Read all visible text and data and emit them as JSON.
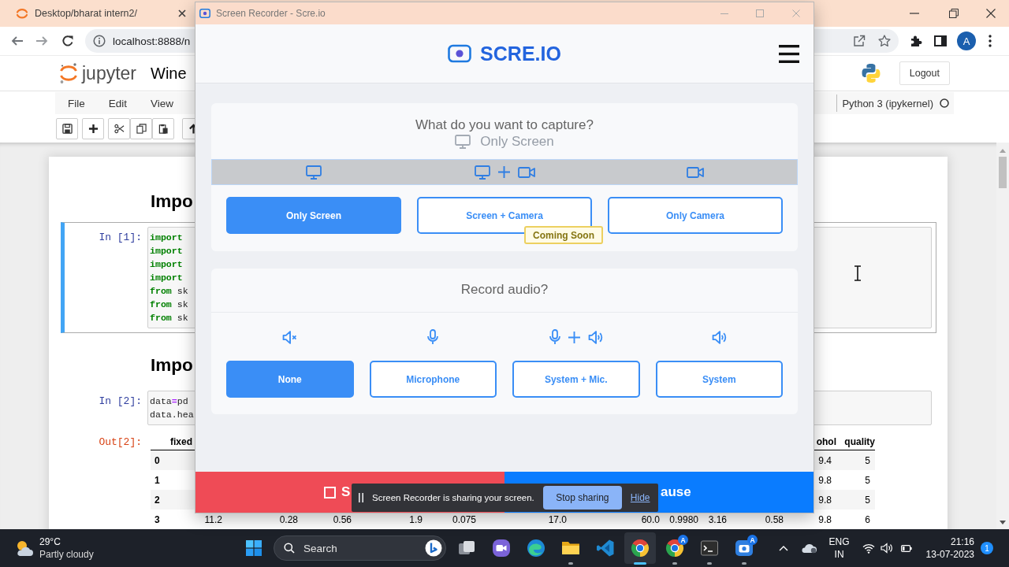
{
  "browser": {
    "tab_title": "Desktop/bharat intern2/",
    "url": "localhost:8888/n",
    "profile_initial": "A"
  },
  "jupyter": {
    "brand": "jupyter",
    "notebook_title": "Wine",
    "logout": "Logout",
    "menu": [
      "File",
      "Edit",
      "View"
    ],
    "kernel": "Python 3 (ipykernel)",
    "kernel_busy": false
  },
  "notebook": {
    "cells": [
      {
        "kind": "heading",
        "text": "Impo"
      },
      {
        "kind": "code",
        "prompt": "In [1]:",
        "selected": true,
        "lines": [
          [
            {
              "kind": "keyword",
              "text": "import"
            }
          ],
          [
            {
              "kind": "keyword",
              "text": "import"
            }
          ],
          [
            {
              "kind": "keyword",
              "text": "import"
            }
          ],
          [
            {
              "kind": "keyword",
              "text": "import"
            }
          ],
          [
            {
              "kind": "keyword",
              "text": "from"
            },
            {
              "kind": "name",
              "text": " sk"
            }
          ],
          [
            {
              "kind": "keyword",
              "text": "from"
            },
            {
              "kind": "name",
              "text": " sk"
            }
          ],
          [
            {
              "kind": "keyword",
              "text": "from"
            },
            {
              "kind": "name",
              "text": " sk"
            }
          ]
        ]
      },
      {
        "kind": "heading",
        "text": "Impo"
      },
      {
        "kind": "code",
        "prompt": "In [2]:",
        "selected": false,
        "lines": [
          [
            {
              "kind": "name",
              "text": "data"
            },
            {
              "kind": "operator",
              "text": "="
            },
            {
              "kind": "name",
              "text": "pd"
            }
          ],
          [
            {
              "kind": "name",
              "text": "data.hea"
            }
          ]
        ]
      },
      {
        "kind": "output",
        "prompt": "Out[2]:",
        "table": {
          "columns_left": [
            "fixed"
          ],
          "columns_right": [
            "ohol",
            "quality"
          ],
          "rows": [
            {
              "index": "0",
              "cells": [
                "9.4",
                "5"
              ]
            },
            {
              "index": "1",
              "cells": [
                "9.8",
                "5"
              ]
            },
            {
              "index": "2",
              "cells": [
                "9.8",
                "5"
              ]
            },
            {
              "index": "3",
              "cells": [
                "11.2",
                "0.28",
                "0.56",
                "1.9",
                "0.075",
                "17.0",
                "60.0",
                "0.9980",
                "3.16",
                "0.58",
                "9.8",
                "6"
              ]
            }
          ]
        }
      }
    ]
  },
  "recorder": {
    "title": "Screen Recorder - Scre.io",
    "brand": "SCRE.IO",
    "sections": [
      {
        "kind": "capture",
        "question": "What do you want to capture?",
        "drag_ghost": "Only Screen",
        "options": [
          {
            "kind": "screen",
            "label": "Only Screen",
            "selected": true
          },
          {
            "kind": "screencam",
            "label": "Screen + Camera",
            "selected": false,
            "badge": "Coming Soon"
          },
          {
            "kind": "camera",
            "label": "Only Camera",
            "selected": false
          }
        ]
      },
      {
        "kind": "audio",
        "question": "Record audio?",
        "options": [
          {
            "kind": "none",
            "label": "None",
            "selected": true
          },
          {
            "kind": "mic",
            "label": "Microphone",
            "selected": false
          },
          {
            "kind": "micsystem",
            "label": "System + Mic.",
            "selected": false
          },
          {
            "kind": "system",
            "label": "System",
            "selected": false
          }
        ]
      }
    ],
    "actions": [
      {
        "kind": "stop",
        "label": "S"
      },
      {
        "kind": "pause",
        "label": "ause"
      }
    ]
  },
  "share_bar": {
    "message": "Screen Recorder is sharing your screen.",
    "stop": "Stop sharing",
    "hide": "Hide"
  },
  "taskbar": {
    "weather": {
      "temperature": "29°C",
      "condition": "Partly cloudy"
    },
    "search": {
      "placeholder": "Search"
    },
    "apps": [
      {
        "kind": "taskview",
        "open": false,
        "selected": false
      },
      {
        "kind": "meet",
        "open": false,
        "selected": false
      },
      {
        "kind": "edge",
        "open": false,
        "selected": false
      },
      {
        "kind": "folder",
        "open": true,
        "selected": false
      },
      {
        "kind": "vscode",
        "open": false,
        "selected": false
      },
      {
        "kind": "chrome",
        "open": true,
        "selected": true
      },
      {
        "kind": "chrome",
        "open": true,
        "selected": false,
        "badge": "A"
      },
      {
        "kind": "terminal",
        "open": true,
        "selected": false
      },
      {
        "kind": "camera",
        "open": true,
        "selected": false,
        "badge": "A"
      }
    ],
    "tray": {
      "language": "ENG",
      "region": "IN",
      "time": "21:16",
      "date": "13-07-2023",
      "notifications": "1"
    }
  }
}
